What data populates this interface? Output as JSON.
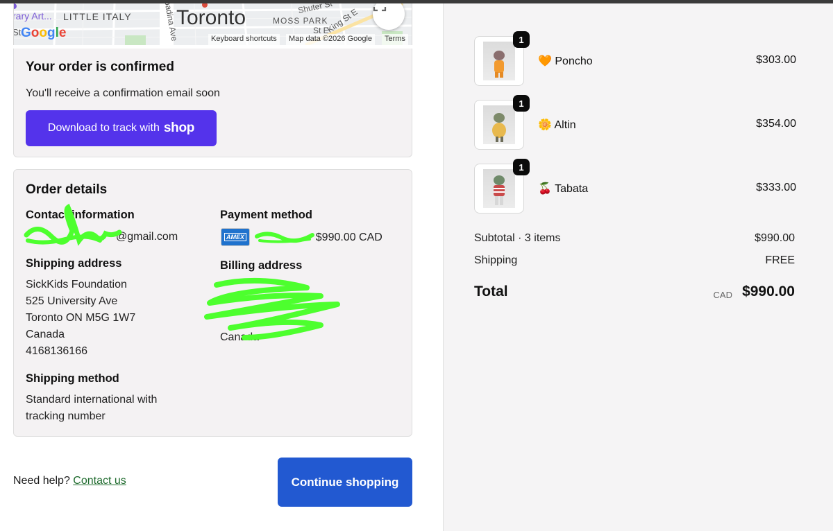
{
  "map": {
    "label_art": "rary Art...",
    "label_little_italy": "LITTLE ITALY",
    "label_city": "Toronto",
    "label_moss_park": "MOSS PARK",
    "label_shuter": "Shuter St",
    "label_king": "King St E",
    "label_spadina": "Spadina Ave",
    "label_st": "St",
    "label_st_e": "St E",
    "google_logo": "Google",
    "attrib_shortcuts": "Keyboard shortcuts",
    "attrib_data": "Map data ©2026 Google",
    "attrib_terms": "Terms"
  },
  "confirmation": {
    "title": "Your order is confirmed",
    "subtitle": "You'll receive a confirmation email soon",
    "track_prefix": "Download to track with",
    "track_brand": "shop"
  },
  "details": {
    "title": "Order details",
    "contact_heading": "Contact information",
    "contact_email": "@gmail.com",
    "payment_heading": "Payment method",
    "payment_card": "AMEX",
    "payment_amount": "· $990.00 CAD",
    "shipping_heading": "Shipping address",
    "shipping_lines": [
      "SickKids Foundation",
      "525 University Ave",
      "Toronto ON M5G 1W7",
      "Canada",
      "4168136166"
    ],
    "billing_heading": "Billing address",
    "billing_country": "Canada",
    "method_heading": "Shipping method",
    "method_lines": [
      "Standard international with",
      "tracking number"
    ]
  },
  "footer": {
    "help_text": "Need help?",
    "contact_link": "Contact us",
    "continue_label": "Continue shopping"
  },
  "cart": {
    "items": [
      {
        "emoji": "🧡",
        "name": "Poncho",
        "price": "$303.00",
        "qty": "1"
      },
      {
        "emoji": "🌼",
        "name": "Altin",
        "price": "$354.00",
        "qty": "1"
      },
      {
        "emoji": "🍒",
        "name": "Tabata",
        "price": "$333.00",
        "qty": "1"
      }
    ],
    "subtotal_label": "Subtotal · 3 items",
    "subtotal_value": "$990.00",
    "shipping_label": "Shipping",
    "shipping_value": "FREE",
    "total_label": "Total",
    "total_currency": "CAD",
    "total_value": "$990.00"
  },
  "colors": {
    "shop_purple": "#5433eb",
    "continue_blue": "#2259d1",
    "redaction_green": "#4dff2e"
  }
}
